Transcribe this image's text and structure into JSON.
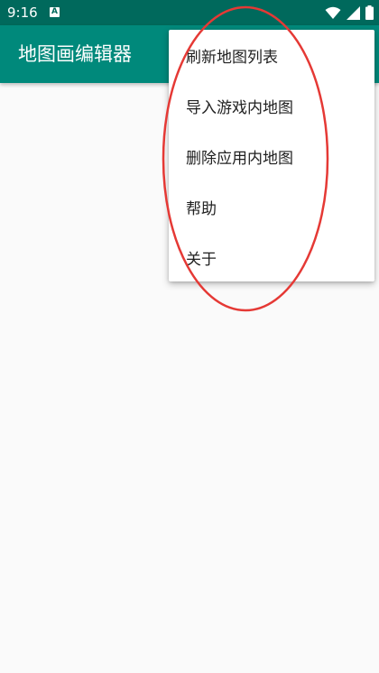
{
  "status_bar": {
    "time": "9:16",
    "notification_letter": "A",
    "icons": [
      "wifi-icon",
      "signal-icon",
      "battery-icon"
    ],
    "background": "#00695c"
  },
  "app_bar": {
    "title": "地图画编辑器",
    "background": "#00897b"
  },
  "overflow_menu": {
    "items": [
      {
        "label": "刷新地图列表"
      },
      {
        "label": "导入游戏内地图"
      },
      {
        "label": "删除应用内地图"
      },
      {
        "label": "帮助"
      },
      {
        "label": "关于"
      }
    ]
  },
  "annotation": {
    "shape": "ellipse",
    "color": "#e53935"
  }
}
